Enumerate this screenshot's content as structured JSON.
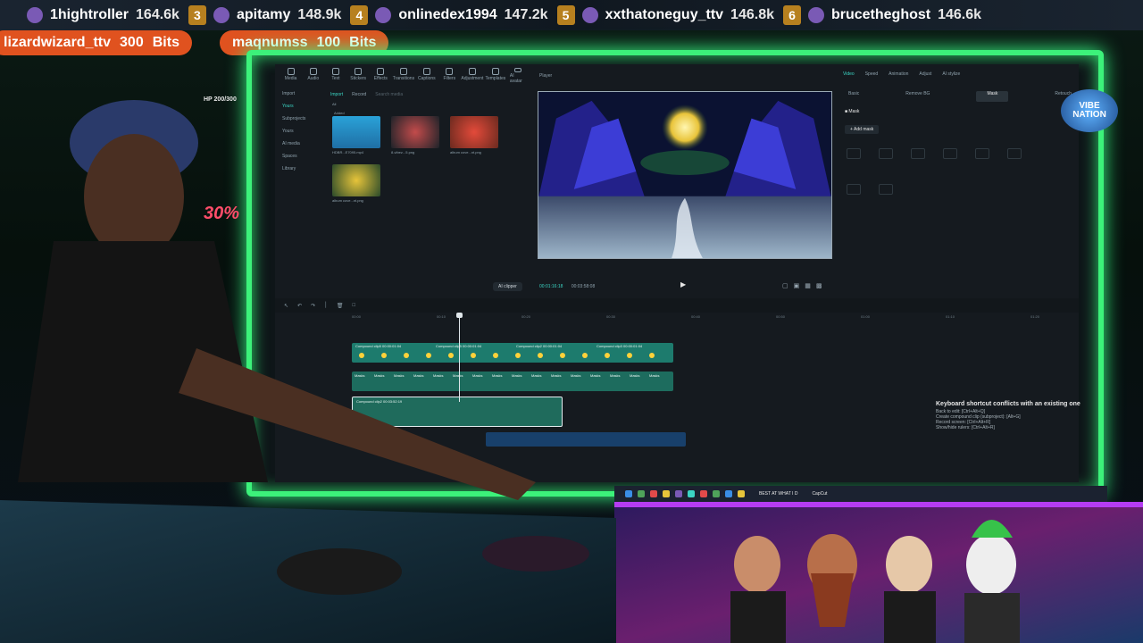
{
  "leaderboard": {
    "entries": [
      {
        "rank": "",
        "name": "1hightroller",
        "score": "164.6k"
      },
      {
        "rank": "3",
        "name": "apitamy",
        "score": "148.9k"
      },
      {
        "rank": "4",
        "name": "onlinedex1994",
        "score": "147.2k"
      },
      {
        "rank": "5",
        "name": "xxthatoneguy_ttv",
        "score": "146.8k"
      },
      {
        "rank": "6",
        "name": "brucetheghost",
        "score": "146.6k"
      }
    ]
  },
  "bits": [
    {
      "name": "lizardwizard_ttv",
      "amount": "300",
      "unit": "Bits"
    },
    {
      "name": "maqnumss",
      "amount": "100",
      "unit": "Bits"
    }
  ],
  "overlay": {
    "hp": "HP 200/300",
    "percent": "30%",
    "logo_line1": "VIBE",
    "logo_line2": "NATION"
  },
  "editor": {
    "toolbar": [
      "Media",
      "Audio",
      "Text",
      "Stickers",
      "Effects",
      "Transitions",
      "Captions",
      "Filters",
      "Adjustment",
      "Templates",
      "AI avatar"
    ],
    "side": [
      "Import",
      "Yours",
      "Subprojects",
      "Yours",
      "AI media",
      "Spaces",
      "Library"
    ],
    "media_tabs": [
      "Import",
      "Record",
      "Search media"
    ],
    "all_label": "All",
    "added_label": "Added",
    "media_items": [
      {
        "caption": "HDBR...E7095.mp4"
      },
      {
        "caption": "8-vibez...5.png"
      },
      {
        "caption": "album cove...nt.png"
      },
      {
        "caption": "album cove...nt.png"
      }
    ],
    "ai_button": "AI clipper",
    "player_label": "Player",
    "timecode_current": "00:01:16:18",
    "timecode_total": "00:03:58:08",
    "props_tabs": [
      "Video",
      "Speed",
      "Animation",
      "Adjust",
      "AI stylize"
    ],
    "props_sub": [
      "Basic",
      "Remove BG",
      "Mask",
      "Retouch"
    ],
    "mask_label": "Mask",
    "add_mask": "Add mask",
    "ruler": [
      "00:00",
      "00:10",
      "00:20",
      "00:30",
      "00:40",
      "00:50",
      "01:00",
      "01:10",
      "01:20"
    ],
    "compound_clips": [
      {
        "label": "Compound clip5  00:00:01:04"
      },
      {
        "label": "Compound clip5  00:00:01:04"
      },
      {
        "label": "Compound clip2  00:00:01:04"
      },
      {
        "label": "Compound clip3  00:00:01:04"
      }
    ],
    "mask_clips": [
      "Masks",
      "Masks",
      "Masks",
      "Masks",
      "Masks",
      "Masks",
      "Masks",
      "Masks",
      "Masks",
      "Masks",
      "Masks",
      "Masks",
      "Masks",
      "Masks",
      "Masks",
      "Masks"
    ],
    "lower_clip": "Compound clip2  00:03:52:19"
  },
  "notification": {
    "title": "Keyboard shortcut conflicts with an existing one",
    "lines": [
      "Back to edit: [Ctrl+Alt+Q]",
      "Create compound clip (subproject): [Alt+G]",
      "Record screen: [Ctrl+Alt+R]",
      "Show/hide rulers: [Ctrl+Alt+R]"
    ]
  },
  "taskbar": {
    "items": [
      "BEST AT WHAT I D",
      "CapCut"
    ]
  },
  "colors": {
    "neon_frame": "#3cf27a",
    "accent_teal": "#3bd5c4",
    "bits_orange": "#e0521f",
    "rank_gold": "#b7801f",
    "percent_red": "#ff4d6a"
  }
}
